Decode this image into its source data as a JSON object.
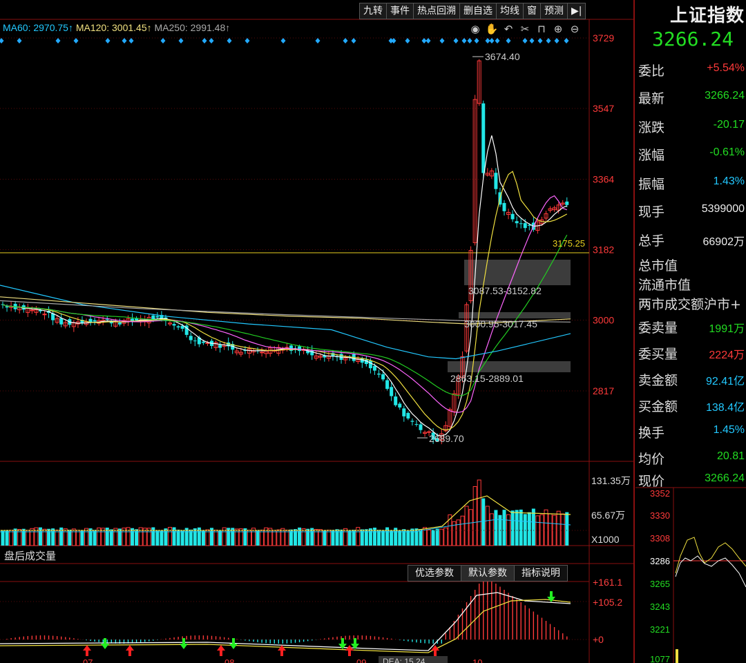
{
  "toolbar": {
    "buttons": [
      "九转",
      "事件",
      "热点回溯",
      "删自选",
      "均线",
      "窗",
      "预测"
    ],
    "collapse_icon": "collapse-right-icon"
  },
  "ma_legend": {
    "ma60": "MA60: 2970.75↑",
    "ma120": "MA120: 3001.45↑",
    "ma250": "MA250: 2991.48↑"
  },
  "tools": [
    "eye-icon",
    "hand-icon",
    "undo-icon",
    "scissors-icon",
    "lock-icon",
    "zoom-in-icon",
    "zoom-out-icon"
  ],
  "price_axis": [
    "3729",
    "3547",
    "3364",
    "3182",
    "3000",
    "2817"
  ],
  "annotations": {
    "high": "3674.40",
    "low": "2689.70",
    "line": "3175.25",
    "gap1": "3087.53-3152.82",
    "gap2": "3000.95-3017.45",
    "gap3": "2863.15-2889.01"
  },
  "volume_axis": [
    "131.35万",
    "65.67万",
    "X1000"
  ],
  "volume_panel_title": "盘后成交量",
  "indicator_tabs": [
    "优选参数",
    "默认参数",
    "指标说明"
  ],
  "indicator_axis": [
    "+161.1",
    "+105.2",
    "+0"
  ],
  "indicator_overlay": "DEA: 15.24",
  "x_axis_months": [
    "07",
    "08",
    "09",
    "10"
  ],
  "quote": {
    "name": "上证指数",
    "price": "3266.24",
    "rows": [
      {
        "label": "委比",
        "value": "+5.54%",
        "color": "red"
      },
      {
        "label": "最新",
        "value": "3266.24",
        "color": "green"
      },
      {
        "label": "涨跌",
        "value": "-20.17",
        "color": "green"
      },
      {
        "label": "涨幅",
        "value": "-0.61%",
        "color": "green"
      },
      {
        "label": "振幅",
        "value": "1.43%",
        "color": "cyan"
      },
      {
        "label": "现手",
        "value": "5399000",
        "color": "white"
      },
      {
        "label": "总手",
        "value": "66902万",
        "color": "white"
      }
    ],
    "extra_rows": [
      "总市值",
      "流通市值",
      "两市成交额沪市+"
    ],
    "rows2": [
      {
        "label": "委卖量",
        "value": "1991万",
        "color": "green"
      },
      {
        "label": "委买量",
        "value": "2224万",
        "color": "red"
      },
      {
        "label": "卖金额",
        "value": "92.41亿",
        "color": "cyan"
      },
      {
        "label": "买金额",
        "value": "138.4亿",
        "color": "cyan"
      },
      {
        "label": "换手",
        "value": "1.45%",
        "color": "cyan"
      },
      {
        "label": "均价",
        "value": "20.81",
        "color": "green"
      }
    ],
    "mini_title": "现价",
    "mini_price": "3266.24",
    "mini_axis": [
      "3352",
      "3330",
      "3308",
      "3286",
      "3265",
      "3243",
      "3221",
      "1077"
    ]
  },
  "colors": {
    "up": "#ff3a3a",
    "down": "#22e6e6",
    "ma5": "#ffffff",
    "ma10": "#f0e040",
    "ma20": "#ff66ff",
    "ma30": "#22cc22",
    "ma60": "#22c8ff",
    "ma120": "#f0e080"
  }
}
